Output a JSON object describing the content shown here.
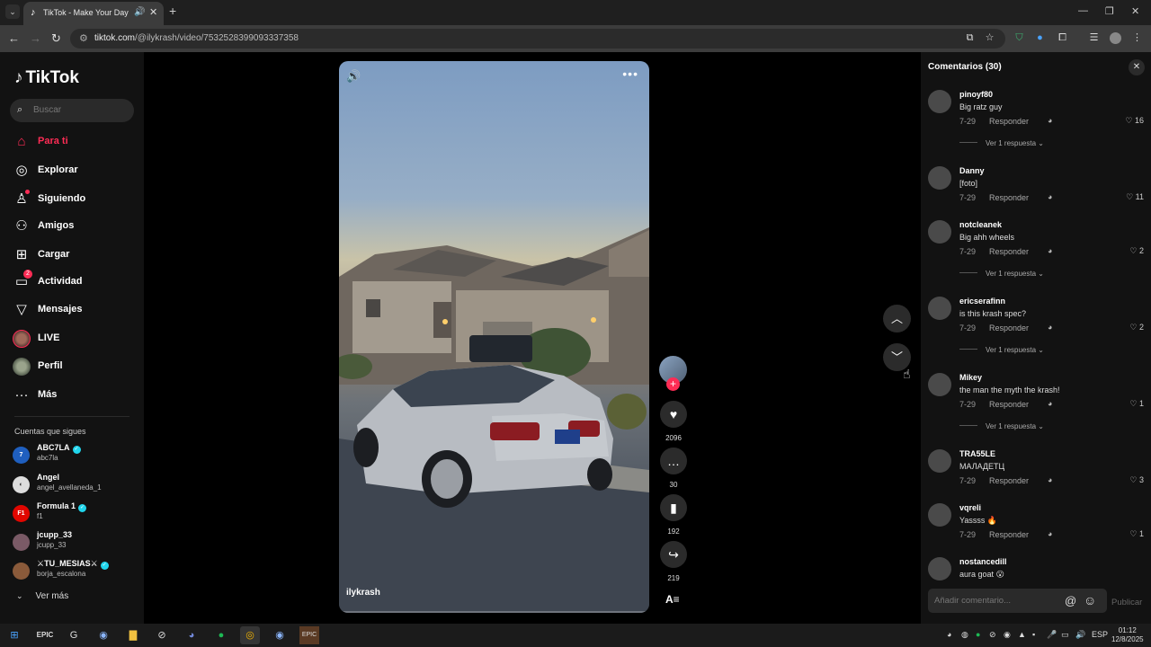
{
  "browser": {
    "tab_title": "TikTok - Make Your Day",
    "url_domain": "tiktok.com",
    "url_path": "/@ilykrash/video/7532528399093337358"
  },
  "sidebar": {
    "logo": "TikTok",
    "search_placeholder": "Buscar",
    "nav": [
      {
        "label": "Para ti",
        "icon": "home-icon",
        "active": true
      },
      {
        "label": "Explorar",
        "icon": "compass-icon"
      },
      {
        "label": "Siguiendo",
        "icon": "following-icon"
      },
      {
        "label": "Amigos",
        "icon": "friends-icon"
      },
      {
        "label": "Cargar",
        "icon": "upload-icon"
      },
      {
        "label": "Actividad",
        "icon": "activity-icon",
        "badge": "2"
      },
      {
        "label": "Mensajes",
        "icon": "messages-icon"
      },
      {
        "label": "LIVE",
        "icon": "live-icon"
      },
      {
        "label": "Perfil",
        "icon": "profile-icon"
      },
      {
        "label": "Más",
        "icon": "more-icon"
      }
    ],
    "following_title": "Cuentas que sigues",
    "accounts": [
      {
        "name": "ABC7LA",
        "handle": "abc7la",
        "verified": true
      },
      {
        "name": "Angel",
        "handle": "angel_avellaneda_1",
        "verified": false
      },
      {
        "name": "Formula 1",
        "handle": "f1",
        "verified": true
      },
      {
        "name": "jcupp_33",
        "handle": "jcupp_33",
        "verified": false
      },
      {
        "name": "⚔TU_MESIAS⚔",
        "handle": "borja_escalona",
        "verified": true
      }
    ],
    "see_more": "Ver más"
  },
  "video": {
    "author": "ilykrash"
  },
  "actions": {
    "likes": "2096",
    "comments": "30",
    "saves": "192",
    "shares": "219"
  },
  "comments_panel": {
    "title": "Comentarios (30)",
    "reply_label": "Responder",
    "view_replies_label": "Ver 1 respuesta",
    "items": [
      {
        "user": "pinoyf80",
        "text": "Big ratz guy",
        "date": "7-29",
        "likes": "16",
        "replies": true
      },
      {
        "user": "Danny",
        "text": "[foto]",
        "date": "7-29",
        "likes": "11",
        "replies": false
      },
      {
        "user": "notcleanek",
        "text": "Big ahh wheels",
        "date": "7-29",
        "likes": "2",
        "replies": true
      },
      {
        "user": "ericserafinn",
        "text": "is this krash spec?",
        "date": "7-29",
        "likes": "2",
        "replies": true
      },
      {
        "user": "Mikey",
        "text": "the man the myth the krash!",
        "date": "7-29",
        "likes": "1",
        "replies": true
      },
      {
        "user": "TRA55LE",
        "text": "МАЛАДЕТЦ",
        "date": "7-29",
        "likes": "3",
        "replies": false
      },
      {
        "user": "vqreli",
        "text": "Yassss 🔥",
        "date": "7-29",
        "likes": "1",
        "replies": false
      },
      {
        "user": "nostancedill",
        "text": "aura goat 😮",
        "date": "",
        "likes": "",
        "replies": false
      }
    ],
    "input_placeholder": "Añadir comentario...",
    "post_label": "Publicar"
  },
  "taskbar": {
    "language": "ESP",
    "time": "01:12",
    "date": "12/8/2025"
  },
  "colors": {
    "accent": "#fe2c55",
    "verified": "#20d5ec",
    "background": "#000000",
    "panel": "#121212"
  }
}
